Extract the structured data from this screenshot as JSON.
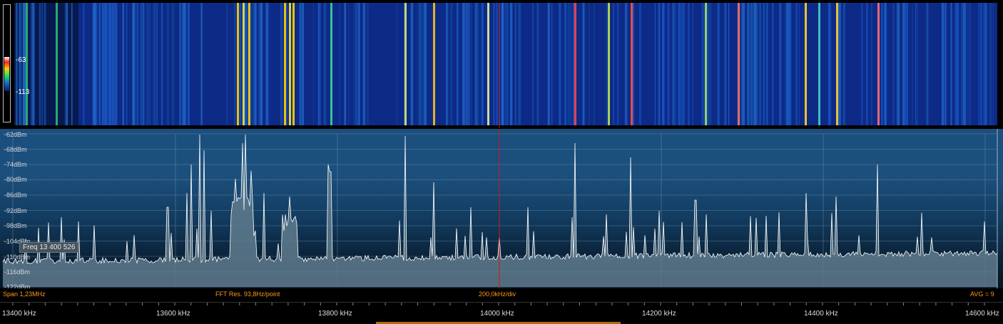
{
  "waterfall": {
    "scale_max": "-63",
    "scale_min": "-113"
  },
  "spectrum": {
    "db_labels": [
      "-62dBm",
      "-68dBm",
      "-74dBm",
      "-80dBm",
      "-86dBm",
      "-92dBm",
      "-98dBm",
      "-104dBm",
      "-110dBm",
      "-116dBm",
      "-122dBm"
    ],
    "tooltip": "Freq 13 400 526"
  },
  "info": {
    "span": "Span 1,23MHz",
    "fft": "FFT Res. 93,8Hz/point",
    "div": "200,0kHz/div",
    "avg": "AVG = 9"
  },
  "axis": {
    "labels": [
      "13400 kHz",
      "13600 kHz",
      "13800 kHz",
      "14000 kHz",
      "14200 kHz",
      "14400 kHz",
      "14600 kHz"
    ]
  },
  "colors": {
    "accent": "#ff9a1a",
    "cursor": "#d01818",
    "trace": "#ffffff"
  }
}
